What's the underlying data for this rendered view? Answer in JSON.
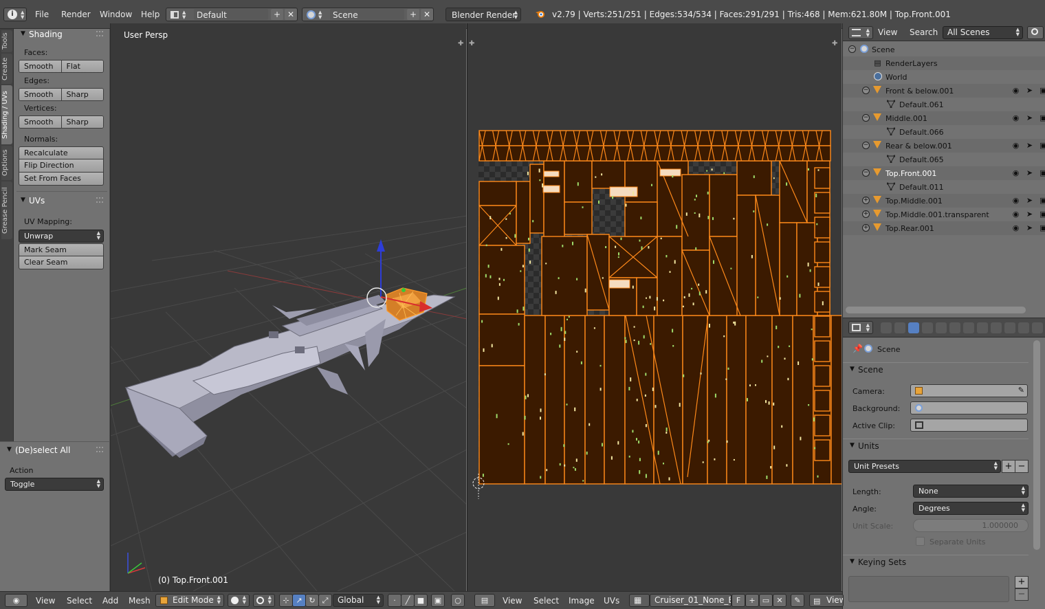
{
  "topbar": {
    "menus": [
      "File",
      "Render",
      "Window",
      "Help"
    ],
    "layout": "Default",
    "scene": "Scene",
    "engine": "Blender Render",
    "stats": "v2.79 | Verts:251/251 | Edges:534/534 | Faces:291/291 | Tris:468 | Mem:621.80M | Top.Front.001"
  },
  "tabs": [
    "Tools",
    "Create",
    "Shading / UVs",
    "Options",
    "Grease Pencil"
  ],
  "shelf": {
    "shading_title": "Shading",
    "faces_label": "Faces:",
    "faces_buttons": [
      "Smooth",
      "Flat"
    ],
    "edges_label": "Edges:",
    "edges_buttons": [
      "Smooth",
      "Sharp"
    ],
    "vertices_label": "Vertices:",
    "vertices_buttons": [
      "Smooth",
      "Sharp"
    ],
    "normals_label": "Normals:",
    "normals_buttons": [
      "Recalculate",
      "Flip Direction",
      "Set From Faces"
    ],
    "uvs_title": "UVs",
    "uv_mapping_label": "UV Mapping:",
    "unwrap": "Unwrap",
    "uv_buttons": [
      "Mark Seam",
      "Clear Seam"
    ]
  },
  "operator": {
    "title": "(De)select All",
    "action_label": "Action",
    "action_value": "Toggle"
  },
  "viewport": {
    "view_label": "User Persp",
    "object_label": "(0) Top.Front.001"
  },
  "header3d": {
    "menus": [
      "View",
      "Select",
      "Add",
      "Mesh"
    ],
    "mode": "Edit Mode",
    "orientation": "Global"
  },
  "uvheader": {
    "menus": [
      "View",
      "Select",
      "Image",
      "UVs"
    ],
    "image": "Cruiser_01_None_E...",
    "f_label": "F",
    "view_label": "View"
  },
  "outliner": {
    "menus": [
      "View",
      "Search"
    ],
    "filter": "All Scenes",
    "rows": [
      {
        "name": "Scene",
        "indent": 0
      },
      {
        "name": "RenderLayers",
        "indent": 1
      },
      {
        "name": "World",
        "indent": 1
      },
      {
        "name": "Front & below.001",
        "indent": 1
      },
      {
        "name": "Default.061",
        "indent": 2
      },
      {
        "name": "Middle.001",
        "indent": 1
      },
      {
        "name": "Default.066",
        "indent": 2
      },
      {
        "name": "Rear & below.001",
        "indent": 1
      },
      {
        "name": "Default.065",
        "indent": 2
      },
      {
        "name": "Top.Front.001",
        "indent": 1
      },
      {
        "name": "Default.011",
        "indent": 2
      },
      {
        "name": "Top.Middle.001",
        "indent": 1
      },
      {
        "name": "Top.Middle.001.transparent",
        "indent": 1
      },
      {
        "name": "Top.Rear.001",
        "indent": 1
      }
    ]
  },
  "properties": {
    "context": "Scene",
    "scene_panel": "Scene",
    "camera_label": "Camera:",
    "background_label": "Background:",
    "active_clip_label": "Active Clip:",
    "units_panel": "Units",
    "unit_presets": "Unit Presets",
    "length_label": "Length:",
    "length_value": "None",
    "angle_label": "Angle:",
    "angle_value": "Degrees",
    "unit_scale_label": "Unit Scale:",
    "unit_scale_value": "1.000000",
    "separate_units": "Separate Units",
    "keying_panel": "Keying Sets"
  },
  "colors": {
    "uv_fill": "#3b1a00",
    "uv_edge": "#ff8a1a",
    "accent_blue": "#5680c2"
  }
}
